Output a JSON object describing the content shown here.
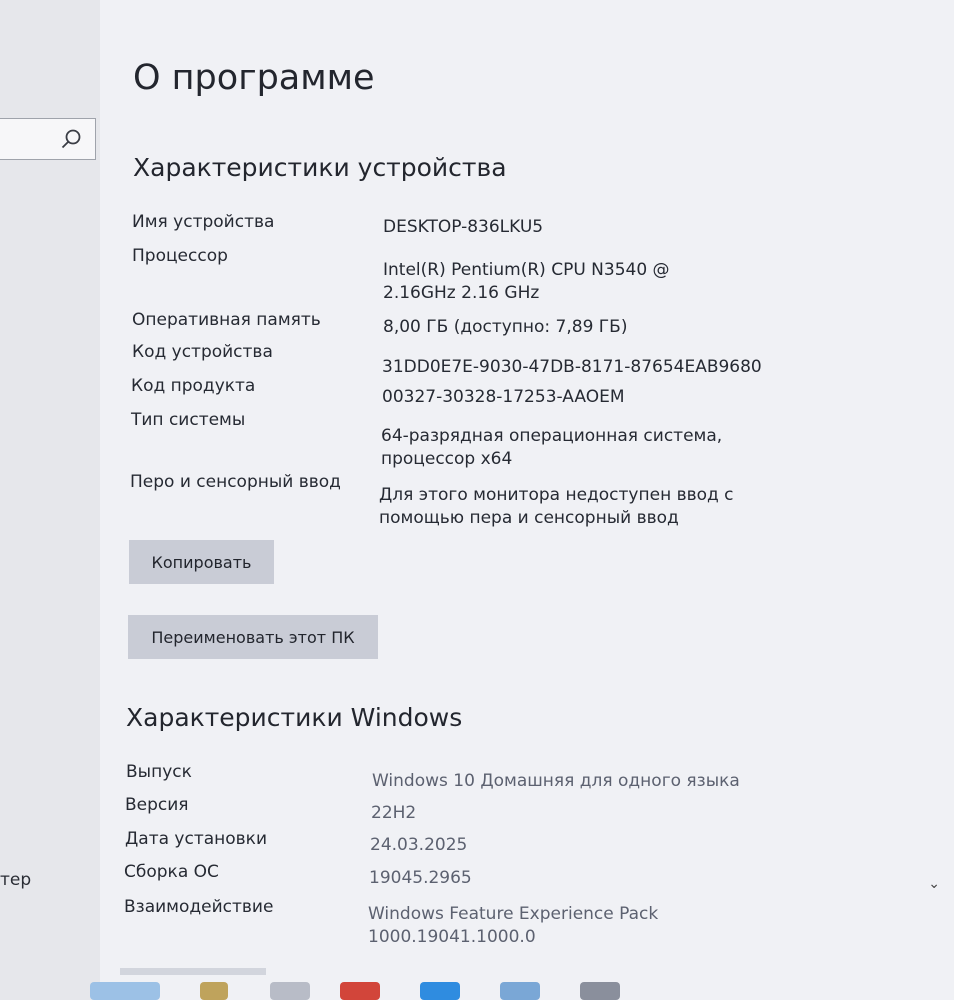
{
  "side": {
    "partial_label": "тер"
  },
  "page": {
    "title": "О программе"
  },
  "device": {
    "section_title": "Характеристики устройства",
    "rows": [
      {
        "label": "Имя устройства",
        "value": [
          "DESKTOP-836LKU5"
        ]
      },
      {
        "label": "Процессор",
        "value": [
          "Intel(R) Pentium(R) CPU  N3540  @",
          "2.16GHz   2.16 GHz"
        ]
      },
      {
        "label": "Оперативная память",
        "value": [
          "8,00 ГБ (доступно: 7,89 ГБ)"
        ]
      },
      {
        "label": "Код устройства",
        "value": [
          "31DD0E7E-9030-47DB-8171-87654EAB9680"
        ]
      },
      {
        "label": "Код продукта",
        "value": [
          "00327-30328-17253-AAOEM"
        ]
      },
      {
        "label": "Тип системы",
        "value": [
          "64-разрядная операционная система,",
          "процессор x64"
        ]
      },
      {
        "label": "Перо и сенсорный ввод",
        "value": [
          "Для этого монитора недоступен ввод с",
          "помощью пера и сенсорный ввод"
        ]
      }
    ],
    "copy_button": "Копировать",
    "rename_button": "Переименовать этот ПК"
  },
  "windows": {
    "section_title": "Характеристики Windows",
    "rows": [
      {
        "label": "Выпуск",
        "value": [
          "Windows 10 Домашняя для одного языка"
        ]
      },
      {
        "label": "Версия",
        "value": [
          "22H2"
        ]
      },
      {
        "label": "Дата установки",
        "value": [
          "24.03.2025"
        ]
      },
      {
        "label": "Сборка ОС",
        "value": [
          "19045.2965"
        ]
      },
      {
        "label": "Взаимодействие",
        "value": [
          "Windows Feature Experience Pack",
          "1000.19041.1000.0"
        ]
      }
    ]
  }
}
